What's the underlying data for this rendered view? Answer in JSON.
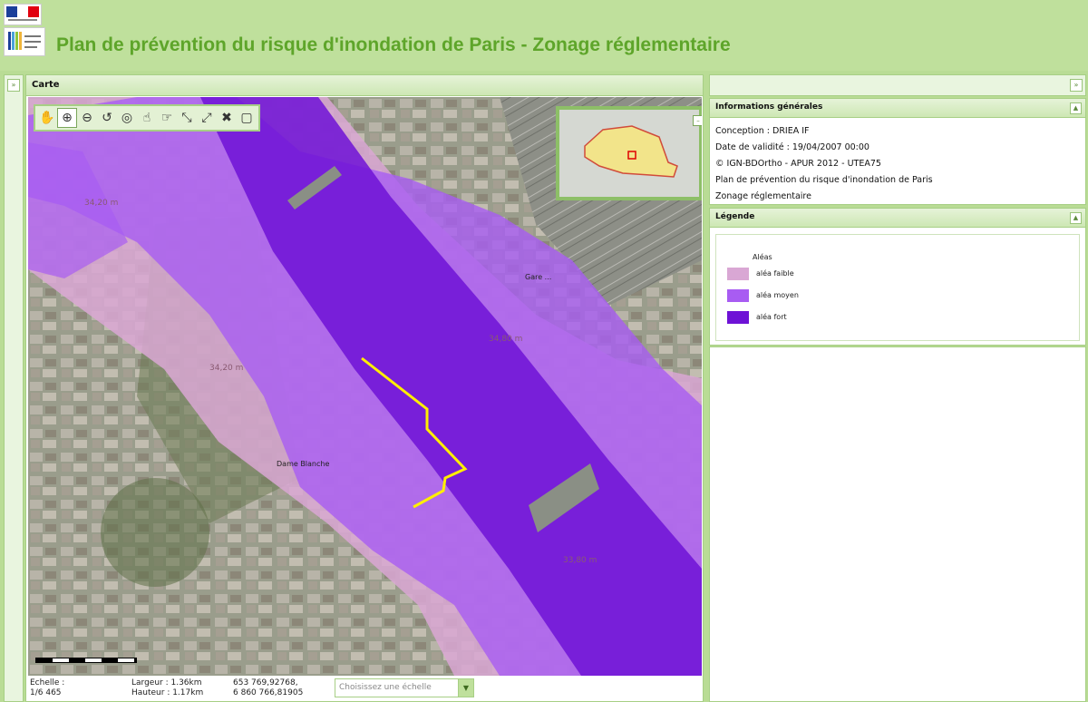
{
  "header": {
    "title": "Plan de prévention du risque d'inondation de Paris - Zonage réglementaire",
    "flag_logo": "République Française",
    "ministry_logo": "Ministère"
  },
  "map_panel": {
    "title": "Carte",
    "toolbar": [
      {
        "name": "pan-tool",
        "icon": "hand",
        "glyph": "✋"
      },
      {
        "name": "zoom-box-tool",
        "icon": "zoom-box",
        "glyph": "⊕"
      },
      {
        "name": "zoom-out-tool",
        "icon": "zoom-out",
        "glyph": "⊖"
      },
      {
        "name": "previous-view-tool",
        "icon": "back-arrow",
        "glyph": "↺"
      },
      {
        "name": "full-extent-tool",
        "icon": "globe",
        "glyph": "◎"
      },
      {
        "name": "info-tool",
        "icon": "pointer-info",
        "glyph": "☝"
      },
      {
        "name": "select-tool",
        "icon": "pointer-select",
        "glyph": "☞"
      },
      {
        "name": "measure-distance-tool",
        "icon": "measure-line",
        "glyph": "⤡"
      },
      {
        "name": "measure-area-tool",
        "icon": "measure-area",
        "glyph": "⤢"
      },
      {
        "name": "clear-tool",
        "icon": "eraser",
        "glyph": "✖"
      },
      {
        "name": "print-tool",
        "icon": "page",
        "glyph": "▢"
      }
    ],
    "altitude_labels": [
      "34,20 m",
      "34,20 m",
      "34,80 m",
      "33,80 m"
    ],
    "place_labels": [
      "Gare ...",
      "Dame Blanche"
    ],
    "statusbar": {
      "scale_label": "Echelle :",
      "scale_value": "1/6 465",
      "width_label": "Largeur : 1.36km",
      "height_label": "Hauteur : 1.17km",
      "coord_x": "653 769,92768,",
      "coord_y": "6 860 766,81905",
      "scale_select_placeholder": "Choisissez une échelle"
    }
  },
  "info_panel": {
    "title": "Informations générales",
    "lines": [
      "Conception : DRIEA IF",
      "Date de validité : 19/04/2007 00:00",
      "© IGN-BDOrtho - APUR 2012 - UTEA75",
      "Plan de prévention du risque d'inondation de Paris",
      "Zonage réglementaire"
    ]
  },
  "legend_panel": {
    "title": "Légende",
    "subtitle": "Aléas",
    "items": [
      {
        "label": "aléa faible",
        "color": "#d9a7d4"
      },
      {
        "label": "aléa moyen",
        "color": "#a85cf2"
      },
      {
        "label": "aléa fort",
        "color": "#6e12d6"
      }
    ]
  },
  "colors": {
    "header_bg": "#bfe09c",
    "title_green": "#5ea52a",
    "panel_border": "#a7cf85",
    "hazard_low": "#d9a7d4",
    "hazard_medium": "#a85cf2",
    "hazard_high": "#6e12d6",
    "annotation": "#ffee00"
  }
}
